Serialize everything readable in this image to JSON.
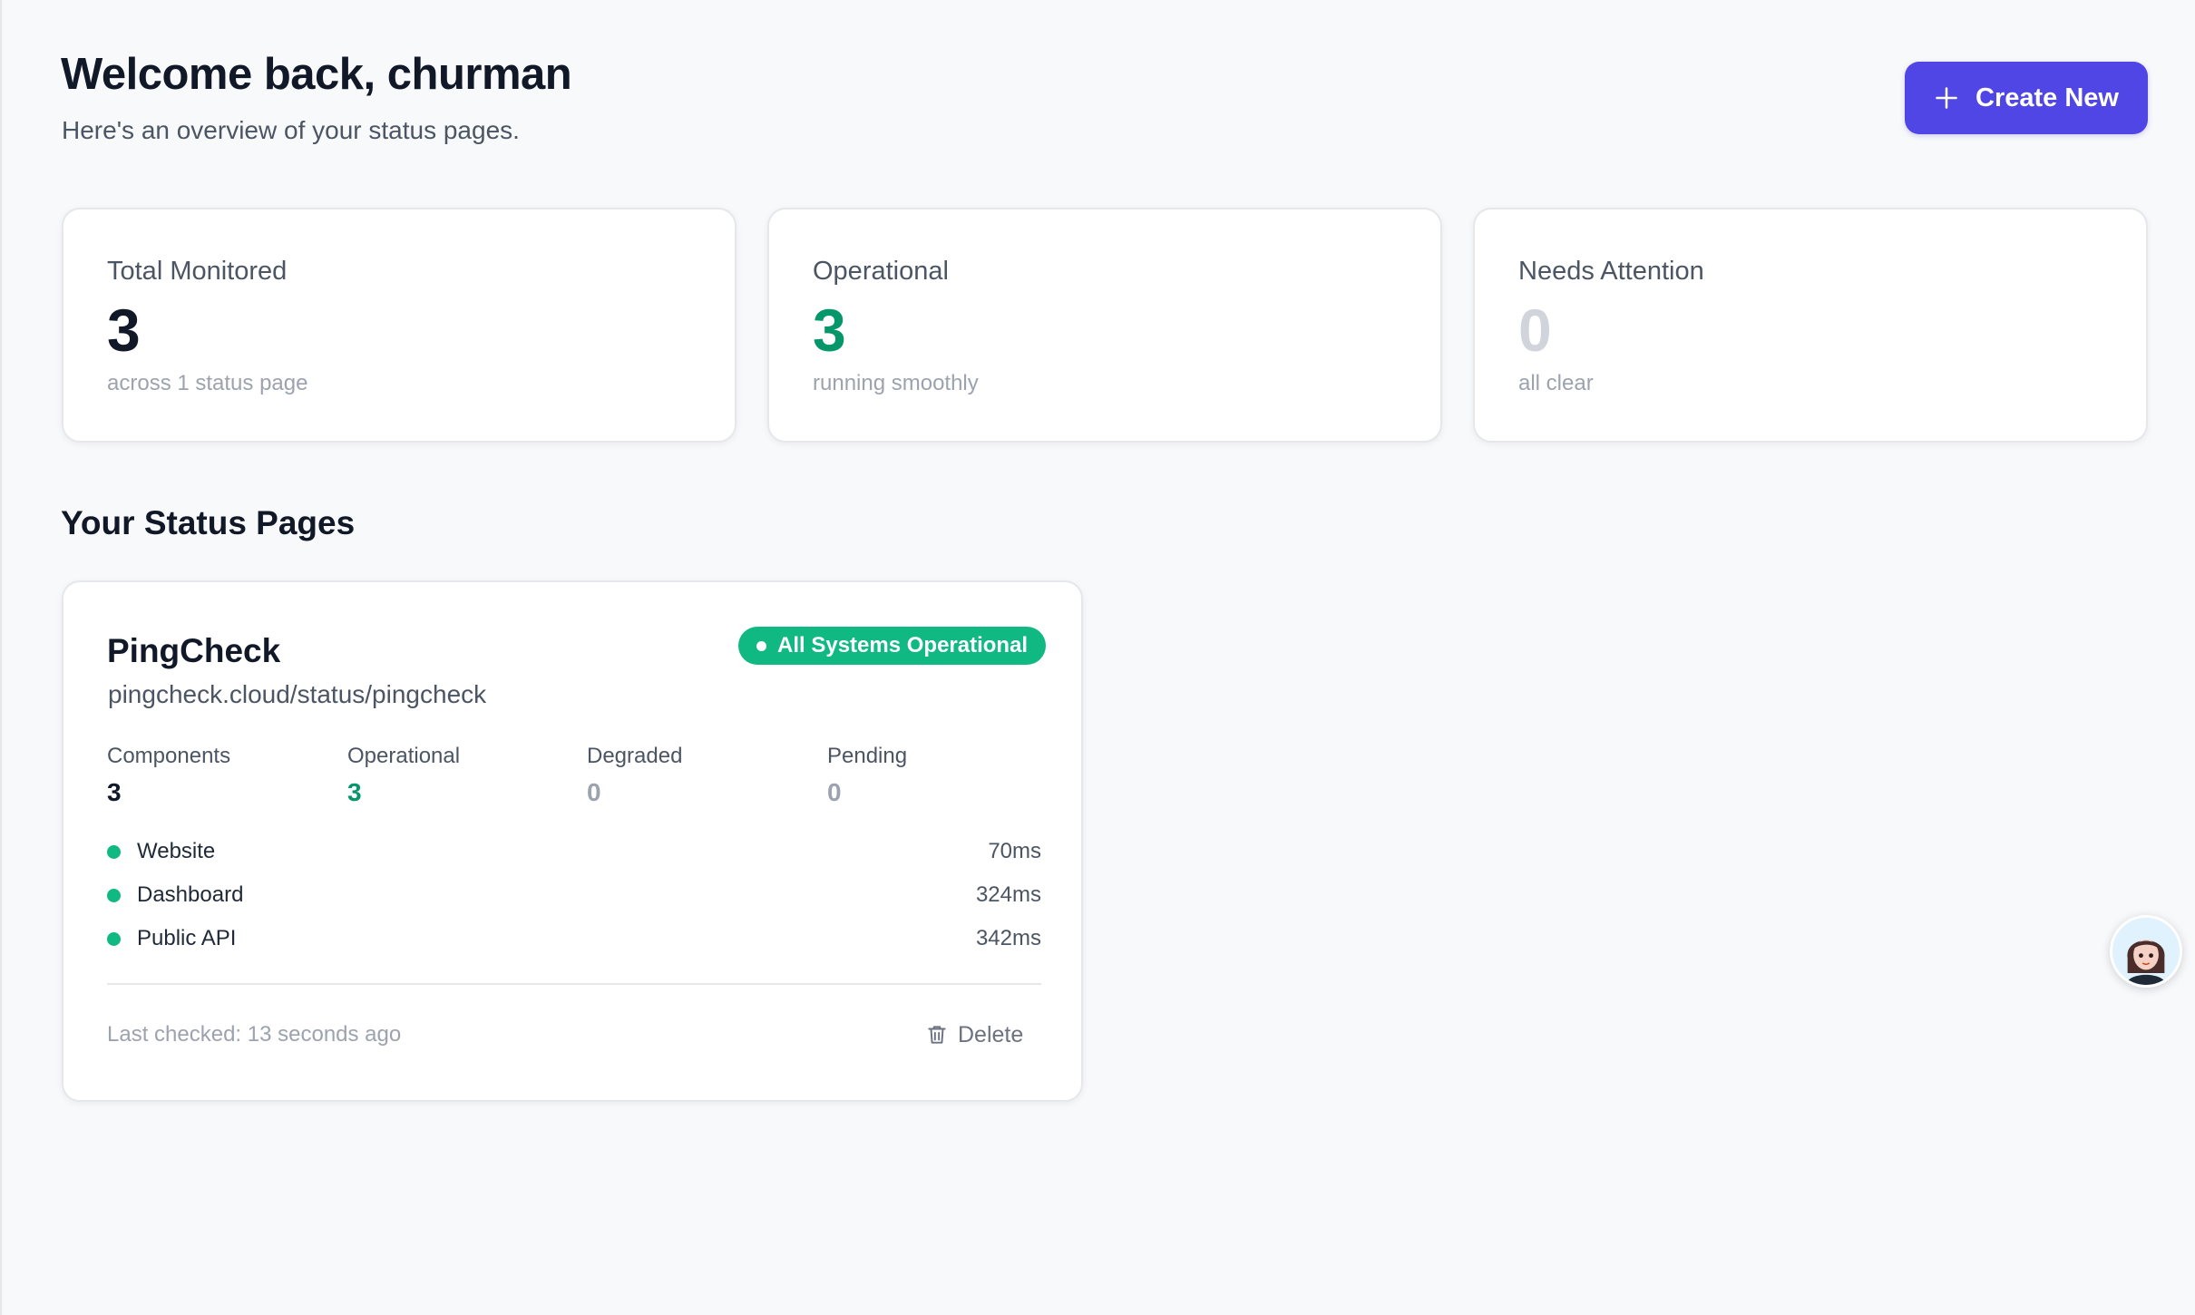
{
  "header": {
    "greeting": "Welcome back, churman",
    "subtitle": "Here's an overview of your status pages.",
    "create_label": "Create New"
  },
  "stats": [
    {
      "label": "Total Monitored",
      "value": "3",
      "note": "across 1 status page",
      "color": "#111827"
    },
    {
      "label": "Operational",
      "value": "3",
      "note": "running smoothly",
      "color": "#059669"
    },
    {
      "label": "Needs Attention",
      "value": "0",
      "note": "all clear",
      "color": "#d1d5db"
    }
  ],
  "section_title": "Your Status Pages",
  "status_page": {
    "name": "PingCheck",
    "url": "pingcheck.cloud/status/pingcheck",
    "badge": "All Systems Operational",
    "metrics": [
      {
        "label": "Components",
        "value": "3",
        "color": "#111827"
      },
      {
        "label": "Operational",
        "value": "3",
        "color": "#059669"
      },
      {
        "label": "Degraded",
        "value": "0",
        "color": "#9ca3af"
      },
      {
        "label": "Pending",
        "value": "0",
        "color": "#9ca3af"
      }
    ],
    "components": [
      {
        "name": "Website",
        "latency": "70ms",
        "status_color": "#10b981"
      },
      {
        "name": "Dashboard",
        "latency": "324ms",
        "status_color": "#10b981"
      },
      {
        "name": "Public API",
        "latency": "342ms",
        "status_color": "#10b981"
      }
    ],
    "last_checked": "Last checked: 13 seconds ago",
    "delete_label": "Delete"
  },
  "colors": {
    "accent": "#4f46e5",
    "success": "#10b981"
  },
  "icons": {
    "create": "plus-icon",
    "delete": "trash-icon",
    "assistant": "assistant-avatar"
  }
}
